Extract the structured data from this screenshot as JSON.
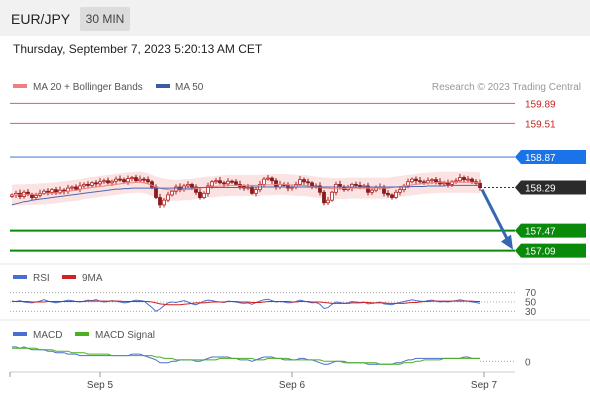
{
  "header": {
    "symbol": "EUR/JPY",
    "timeframe": "30 MIN"
  },
  "datetime": "Thursday, September 7, 2023 5:20:13 AM CET",
  "credit": "Research © 2023 Trading Central",
  "legend": {
    "ma20": "MA 20 + Bollinger Bands",
    "ma50": "MA 50",
    "rsi": "RSI",
    "rsi_ma": "9MA",
    "macd": "MACD",
    "macd_signal": "MACD Signal"
  },
  "colors": {
    "up": "#b22222",
    "down": "#8b1a1a",
    "ma20": "#f08080",
    "ma50": "#4a6ab5",
    "bands": "#fbe3e3",
    "resistance": "#ee5555",
    "pivot": "#4a86e8",
    "support": "#0a8a0a",
    "rsi": "#4a6fd1",
    "rsi_ma": "#d42020",
    "macd_signal": "#4caf1f",
    "arrow": "#3568b0"
  },
  "chart_data": [
    {
      "type": "candlestick",
      "ylim": [
        156.95,
        160.05
      ],
      "x_ticks": [
        {
          "label": "Sep 5",
          "index": 22
        },
        {
          "label": "Sep 6",
          "index": 70
        },
        {
          "label": "Sep 7",
          "index": 118
        }
      ],
      "levels": [
        {
          "value": 159.89,
          "label": "159.89",
          "role": "resistance"
        },
        {
          "value": 159.51,
          "label": "159.51",
          "role": "resistance"
        },
        {
          "value": 158.87,
          "label": "158.87",
          "role": "pivot"
        },
        {
          "value": 158.29,
          "label": "158.29",
          "role": "last"
        },
        {
          "value": 157.47,
          "label": "157.47",
          "role": "support"
        },
        {
          "value": 157.09,
          "label": "157.09",
          "role": "support"
        }
      ],
      "forecast": {
        "from": 158.29,
        "to": 157.09
      },
      "closes": [
        158.15,
        158.18,
        158.12,
        158.2,
        158.16,
        158.1,
        158.14,
        158.18,
        158.22,
        158.2,
        158.25,
        158.19,
        158.24,
        158.22,
        158.28,
        158.3,
        158.26,
        158.32,
        158.35,
        158.33,
        158.38,
        158.36,
        158.4,
        158.42,
        158.38,
        158.41,
        158.45,
        158.44,
        158.4,
        158.46,
        158.48,
        158.42,
        158.45,
        158.44,
        158.4,
        158.3,
        158.1,
        157.96,
        158.05,
        158.15,
        158.22,
        158.3,
        158.25,
        158.32,
        158.35,
        158.3,
        158.2,
        158.1,
        158.18,
        158.32,
        158.4,
        158.42,
        158.38,
        158.36,
        158.41,
        158.4,
        158.35,
        158.31,
        158.28,
        158.3,
        158.18,
        158.25,
        158.35,
        158.45,
        158.47,
        158.42,
        158.3,
        158.35,
        158.33,
        158.28,
        158.3,
        158.35,
        158.44,
        158.4,
        158.38,
        158.3,
        158.32,
        158.2,
        158.0,
        158.05,
        158.2,
        158.35,
        158.3,
        158.25,
        158.28,
        158.35,
        158.33,
        158.3,
        158.32,
        158.2,
        158.24,
        158.28,
        158.3,
        158.18,
        158.15,
        158.1,
        158.2,
        158.25,
        158.32,
        158.4,
        158.45,
        158.42,
        158.4,
        158.38,
        158.42,
        158.44,
        158.4,
        158.36,
        158.38,
        158.35,
        158.4,
        158.42,
        158.48,
        158.44,
        158.45,
        158.4,
        158.37,
        158.29
      ],
      "ma20": [
        158.14,
        158.15,
        158.15,
        158.15,
        158.16,
        158.16,
        158.16,
        158.17,
        158.17,
        158.18,
        158.18,
        158.19,
        158.2,
        158.21,
        158.22,
        158.23,
        158.24,
        158.25,
        158.27,
        158.28,
        158.29,
        158.3,
        158.31,
        158.32,
        158.33,
        158.34,
        158.35,
        158.36,
        158.37,
        158.38,
        158.38,
        158.39,
        158.39,
        158.38,
        158.36,
        158.33,
        158.3,
        158.28,
        158.26,
        158.25,
        158.24,
        158.24,
        158.24,
        158.25,
        158.25,
        158.26,
        158.27,
        158.28,
        158.29,
        158.3,
        158.3,
        158.31,
        158.32,
        158.32,
        158.33,
        158.33,
        158.33,
        158.33,
        158.33,
        158.33,
        158.33,
        158.33,
        158.33,
        158.34,
        158.34,
        158.34,
        158.35,
        158.35,
        158.35,
        158.34,
        158.34,
        158.33,
        158.33,
        158.33,
        158.32,
        158.31,
        158.3,
        158.29,
        158.28,
        158.28,
        158.27,
        158.27,
        158.27,
        158.27,
        158.28,
        158.28,
        158.28,
        158.28,
        158.28,
        158.28,
        158.28,
        158.28,
        158.28,
        158.28,
        158.28,
        158.29,
        158.3,
        158.31,
        158.32,
        158.33,
        158.34,
        158.35,
        158.36,
        158.37,
        158.37,
        158.38,
        158.38,
        158.39,
        158.39,
        158.39,
        158.39,
        158.39,
        158.39,
        158.39,
        158.39,
        158.39,
        158.38,
        158.38
      ],
      "ma50": [
        157.96,
        157.98,
        158.0,
        158.02,
        158.03,
        158.05,
        158.06,
        158.07,
        158.08,
        158.09,
        158.1,
        158.11,
        158.12,
        158.13,
        158.14,
        158.15,
        158.16,
        158.17,
        158.18,
        158.19,
        158.2,
        158.21,
        158.22,
        158.23,
        158.24,
        158.25,
        158.26,
        158.26,
        158.27,
        158.27,
        158.28,
        158.28,
        158.28,
        158.28,
        158.28,
        158.28,
        158.28,
        158.28,
        158.28,
        158.28,
        158.28,
        158.28,
        158.28,
        158.28,
        158.28,
        158.28,
        158.29,
        158.29,
        158.29,
        158.29,
        158.29,
        158.29,
        158.29,
        158.29,
        158.29,
        158.29,
        158.29,
        158.29,
        158.29,
        158.29,
        158.3,
        158.3,
        158.3,
        158.3,
        158.3,
        158.3,
        158.3,
        158.3,
        158.3,
        158.3,
        158.3,
        158.3,
        158.3,
        158.3,
        158.3,
        158.3,
        158.3,
        158.3,
        158.3,
        158.3,
        158.3,
        158.3,
        158.3,
        158.3,
        158.3,
        158.3,
        158.3,
        158.3,
        158.3,
        158.3,
        158.3,
        158.3,
        158.3,
        158.3,
        158.3,
        158.3,
        158.3,
        158.3,
        158.3,
        158.3,
        158.31,
        158.31,
        158.31,
        158.31,
        158.32,
        158.32,
        158.32,
        158.32,
        158.32,
        158.33,
        158.33,
        158.33,
        158.33,
        158.33,
        158.33,
        158.33,
        158.33,
        158.33
      ],
      "band_width": 0.2
    },
    {
      "type": "line",
      "name": "RSI",
      "ylim": [
        20,
        80
      ],
      "ref_levels": [
        {
          "value": 70,
          "label": "70"
        },
        {
          "value": 50,
          "label": "50"
        },
        {
          "value": 30,
          "label": "30"
        }
      ],
      "rsi": [
        52,
        51,
        53,
        50,
        49,
        48,
        50,
        52,
        55,
        52,
        50,
        48,
        50,
        52,
        54,
        53,
        51,
        50,
        52,
        54,
        53,
        55,
        52,
        50,
        51,
        53,
        52,
        50,
        48,
        49,
        52,
        54,
        53,
        52,
        45,
        38,
        30,
        35,
        42,
        48,
        50,
        49,
        51,
        53,
        50,
        46,
        44,
        48,
        52,
        54,
        53,
        51,
        50,
        49,
        52,
        51,
        50,
        48,
        47,
        48,
        45,
        49,
        52,
        55,
        56,
        53,
        50,
        51,
        50,
        48,
        49,
        51,
        54,
        52,
        50,
        48,
        49,
        45,
        36,
        38,
        45,
        50,
        49,
        47,
        48,
        51,
        50,
        49,
        50,
        46,
        47,
        48,
        50,
        46,
        45,
        44,
        47,
        49,
        51,
        53,
        55,
        53,
        52,
        51,
        53,
        54,
        52,
        50,
        51,
        50,
        52,
        53,
        55,
        53,
        52,
        50,
        49,
        47
      ],
      "rsi_ma": [
        51,
        51,
        51,
        51,
        51,
        50,
        50,
        50,
        50,
        51,
        51,
        51,
        51,
        51,
        51,
        51,
        51,
        51,
        51,
        52,
        52,
        52,
        52,
        52,
        52,
        52,
        52,
        52,
        51,
        51,
        51,
        51,
        51,
        51,
        51,
        50,
        48,
        46,
        45,
        44,
        44,
        44,
        44,
        45,
        46,
        47,
        48,
        48,
        48,
        49,
        50,
        50,
        50,
        50,
        51,
        51,
        51,
        50,
        50,
        50,
        49,
        49,
        49,
        50,
        51,
        51,
        51,
        51,
        51,
        51,
        50,
        50,
        51,
        51,
        51,
        50,
        50,
        50,
        49,
        48,
        47,
        47,
        47,
        47,
        47,
        48,
        48,
        48,
        49,
        49,
        48,
        48,
        48,
        48,
        47,
        47,
        47,
        47,
        47,
        48,
        49,
        49,
        50,
        51,
        51,
        52,
        52,
        52,
        52,
        52,
        52,
        52,
        52,
        52,
        52,
        52,
        51,
        51
      ]
    },
    {
      "type": "line",
      "name": "MACD",
      "ylim": [
        -0.06,
        0.12
      ],
      "ref_levels": [
        {
          "value": 0,
          "label": "0"
        }
      ],
      "macd": [
        0.1,
        0.1,
        0.09,
        0.1,
        0.09,
        0.08,
        0.08,
        0.08,
        0.08,
        0.07,
        0.07,
        0.06,
        0.06,
        0.06,
        0.05,
        0.05,
        0.05,
        0.04,
        0.04,
        0.04,
        0.04,
        0.04,
        0.04,
        0.04,
        0.04,
        0.04,
        0.04,
        0.04,
        0.04,
        0.04,
        0.05,
        0.05,
        0.05,
        0.04,
        0.03,
        0.02,
        0.01,
        -0.01,
        -0.01,
        -0.01,
        0.0,
        0.0,
        0.01,
        0.01,
        0.01,
        0.01,
        0.0,
        0.0,
        0.01,
        0.02,
        0.03,
        0.03,
        0.03,
        0.03,
        0.03,
        0.02,
        0.02,
        0.01,
        0.01,
        0.01,
        0.0,
        0.01,
        0.02,
        0.03,
        0.03,
        0.03,
        0.02,
        0.02,
        0.01,
        0.01,
        0.01,
        0.01,
        0.02,
        0.02,
        0.01,
        0.01,
        0.0,
        -0.01,
        -0.02,
        -0.02,
        -0.01,
        0.0,
        0.0,
        0.0,
        -0.01,
        -0.01,
        -0.01,
        -0.01,
        -0.01,
        -0.02,
        -0.02,
        -0.02,
        -0.02,
        -0.02,
        -0.02,
        -0.02,
        -0.01,
        -0.01,
        0.0,
        0.01,
        0.01,
        0.02,
        0.02,
        0.02,
        0.02,
        0.02,
        0.02,
        0.02,
        0.02,
        0.02,
        0.02,
        0.02,
        0.02,
        0.03,
        0.03,
        0.02,
        0.02,
        0.02
      ],
      "signal": [
        0.09,
        0.09,
        0.09,
        0.09,
        0.09,
        0.09,
        0.09,
        0.08,
        0.08,
        0.08,
        0.08,
        0.07,
        0.07,
        0.07,
        0.07,
        0.06,
        0.06,
        0.06,
        0.06,
        0.05,
        0.05,
        0.05,
        0.05,
        0.05,
        0.05,
        0.04,
        0.04,
        0.04,
        0.04,
        0.04,
        0.04,
        0.04,
        0.04,
        0.04,
        0.04,
        0.04,
        0.03,
        0.03,
        0.02,
        0.02,
        0.02,
        0.01,
        0.01,
        0.01,
        0.01,
        0.01,
        0.01,
        0.01,
        0.01,
        0.01,
        0.01,
        0.01,
        0.02,
        0.02,
        0.02,
        0.02,
        0.02,
        0.02,
        0.02,
        0.02,
        0.02,
        0.01,
        0.01,
        0.01,
        0.02,
        0.02,
        0.02,
        0.02,
        0.02,
        0.02,
        0.01,
        0.01,
        0.01,
        0.01,
        0.01,
        0.01,
        0.01,
        0.01,
        0.0,
        0.0,
        0.0,
        0.0,
        0.0,
        -0.01,
        -0.01,
        -0.01,
        -0.01,
        -0.01,
        -0.01,
        -0.01,
        -0.01,
        -0.01,
        -0.02,
        -0.02,
        -0.02,
        -0.02,
        -0.02,
        -0.02,
        -0.01,
        -0.01,
        -0.01,
        0.0,
        0.0,
        0.01,
        0.01,
        0.01,
        0.01,
        0.01,
        0.02,
        0.02,
        0.02,
        0.02,
        0.02,
        0.02,
        0.02,
        0.02,
        0.02,
        0.02
      ]
    }
  ]
}
